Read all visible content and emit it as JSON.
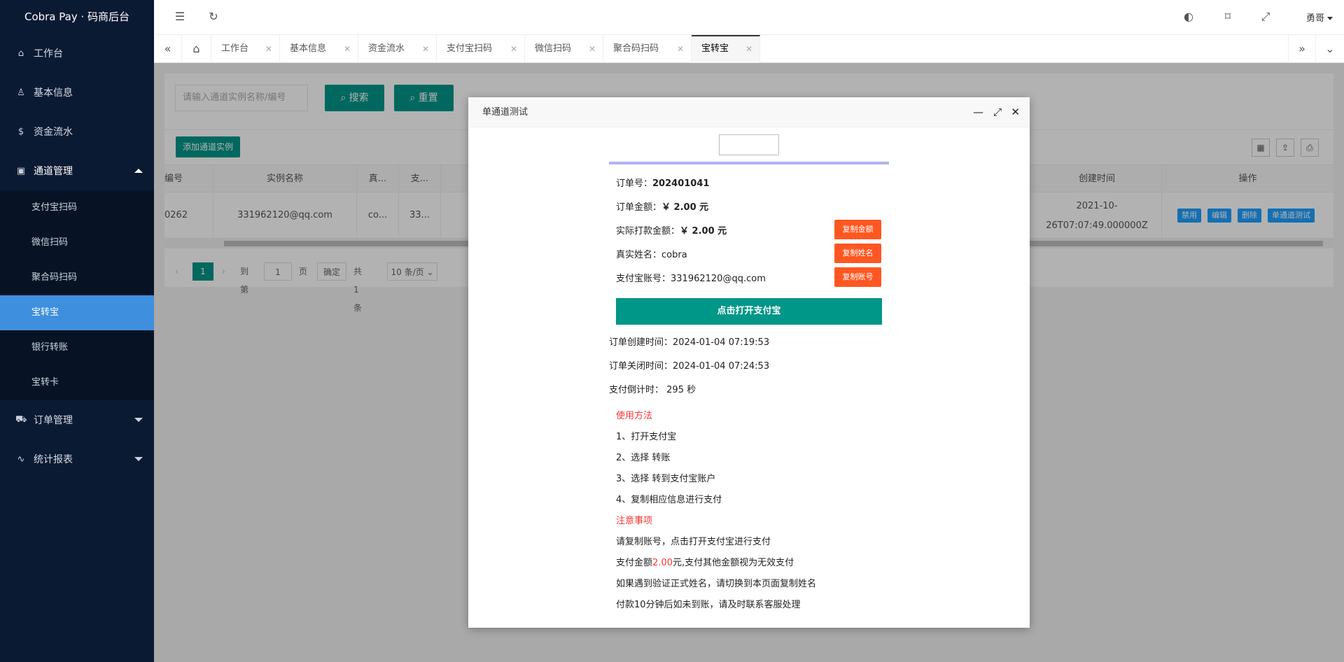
{
  "app": {
    "title": "Cobra Pay · 码商后台"
  },
  "sidebar": {
    "items": [
      {
        "label": "工作台",
        "icon": "home-icon"
      },
      {
        "label": "基本信息",
        "icon": "user-icon"
      },
      {
        "label": "资金流水",
        "icon": "dollar-icon"
      },
      {
        "label": "通道管理",
        "icon": "apps-icon"
      }
    ],
    "sub_items": [
      "支付宝扫码",
      "微信扫码",
      "聚合码扫码",
      "宝转宝",
      "银行转账",
      "宝转卡"
    ],
    "more_items": [
      {
        "label": "订单管理",
        "icon": "cart-icon"
      },
      {
        "label": "统计报表",
        "icon": "chart-icon"
      }
    ]
  },
  "header": {
    "user": "勇哥"
  },
  "tabs": [
    "工作台",
    "基本信息",
    "资金流水",
    "支付宝扫码",
    "微信扫码",
    "聚合码扫码",
    "宝转宝"
  ],
  "main": {
    "search_placeholder": "请输入通道实例名称/编号",
    "search_btn": "搜索",
    "reset_btn": "重置",
    "add_btn": "添加通道实例",
    "columns": [
      "编号",
      "实例名称",
      "真...",
      "支...",
      "创建时间",
      "操作"
    ],
    "row": {
      "id": "0262",
      "name": "331962120@qq.com",
      "real": "co...",
      "pay": "33...",
      "created_line1": "2021-10-",
      "created_line2": "26T07:07:49.000000Z"
    },
    "ops": [
      "禁用",
      "编辑",
      "删除",
      "单通道测试"
    ],
    "pager": {
      "current": "1",
      "goto_label": "到第",
      "page_input": "1",
      "page_label": "页",
      "confirm": "确定",
      "total": "共 1 条",
      "per_page": "10 条/页"
    }
  },
  "dialog": {
    "title": "单通道测试",
    "order_no_label": "订单号：",
    "order_no": "202401041",
    "amount_label": "订单金额：",
    "amount": "￥ 2.00 元",
    "actual_label": "实际打款金额：",
    "actual": "￥ 2.00 元",
    "name_label": "真实姓名：",
    "name": "cobra",
    "account_label": "支付宝账号：",
    "account": "331962120@qq.com",
    "copy_amount": "复制金额",
    "copy_name": "复制姓名",
    "copy_account": "复制账号",
    "open_btn": "点击打开支付宝",
    "created_label": "订单创建时间：",
    "created": "2024-01-04 07:19:53",
    "closed_label": "订单关闭时间：",
    "closed": "2024-01-04 07:24:53",
    "countdown_label": "支付倒计时：",
    "countdown": "295 秒",
    "usage_title": "使用方法",
    "steps": [
      "1、打开支付宝",
      "2、选择 转账",
      "3、选择 转到支付宝账户",
      "4、复制相应信息进行支付"
    ],
    "notice_title": "注意事项",
    "notices": {
      "n1": "请复制账号，点击打开支付宝进行支付",
      "n2_pre": "支付金额",
      "n2_amount": "2.00",
      "n2_post": "元,支付其他金额视为无效支付",
      "n3": "如果遇到验证正式姓名，请切换到本页面复制姓名",
      "n4": "付款10分钟后如未到账，请及时联系客服处理"
    }
  }
}
